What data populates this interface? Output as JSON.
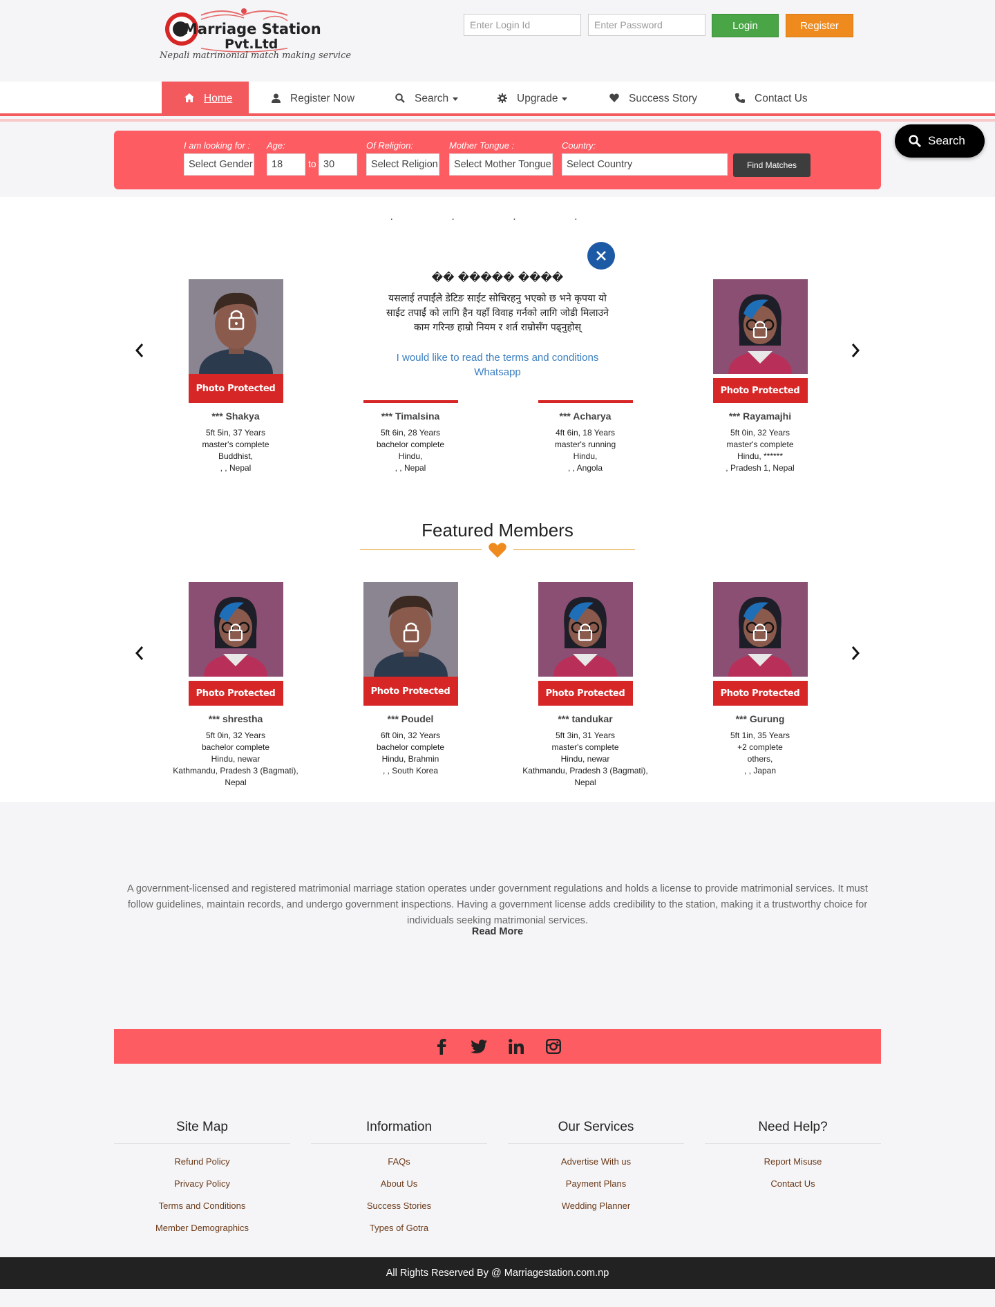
{
  "brand": {
    "name_line1": "Marriage Station",
    "name_line2": "Pvt.Ltd",
    "tagline": "Nepali matrimonial match making service"
  },
  "login": {
    "id_placeholder": "Enter Login Id",
    "password_placeholder": "Enter Password",
    "login_label": "Login",
    "register_label": "Register"
  },
  "nav": {
    "home": "Home",
    "register_now": "Register Now",
    "search": "Search",
    "upgrade": "Upgrade",
    "success_story": "Success Story",
    "contact_us": "Contact Us"
  },
  "search_bar": {
    "looking_for_label": "I am looking for :",
    "gender_value": "Select Gender",
    "age_label": "Age:",
    "age_from": "18",
    "to_label": "to",
    "age_to": "30",
    "religion_label": "Of Religion:",
    "religion_value": "Select Religion",
    "tongue_label": "Mother Tongue :",
    "tongue_value": "Select Mother Tongue",
    "country_label": "Country:",
    "country_value": "Select Country",
    "find_label": "Find Matches"
  },
  "floating_search": {
    "label": "Search"
  },
  "carousel_dots": ". . . .",
  "modal": {
    "title": "�� ����� ����",
    "body": "यसलाई तपाईंले डेटिङ साईट सोचिरहनु भएको छ भने कृपया यो साईट तपाईं को लागि हैन यहाँ विवाह गर्नको लागि जोडी मिलाउने काम गरिन्छ हाम्रो नियम र शर्त राम्रोसँग पढ्नुहोस्",
    "link_terms": "I would like to read the terms and conditions",
    "link_whatsapp": "Whatsapp"
  },
  "photo_protected_label": "Photo Protected",
  "top_members": [
    {
      "name": "*** Shakya",
      "height_age": "5ft 5in, 37 Years",
      "education": "master's complete",
      "religion": "Buddhist,",
      "location": ", , Nepal"
    },
    {
      "name": "*** Timalsina",
      "height_age": "5ft 6in, 28 Years",
      "education": "bachelor complete",
      "religion": "Hindu,",
      "location": ", , Nepal"
    },
    {
      "name": "*** Acharya",
      "height_age": "4ft 6in, 18 Years",
      "education": "master's running",
      "religion": "Hindu,",
      "location": ", , Angola"
    },
    {
      "name": "*** Rayamajhi",
      "height_age": "5ft 0in, 32 Years",
      "education": "master's complete",
      "religion": "Hindu, ******",
      "location": ", Pradesh 1, Nepal"
    }
  ],
  "featured": {
    "title": "Featured Members",
    "members": [
      {
        "name": "*** shrestha",
        "height_age": "5ft 0in, 32 Years",
        "education": "bachelor complete",
        "religion": "Hindu, newar",
        "location": "Kathmandu, Pradesh 3 (Bagmati),",
        "location2": "Nepal"
      },
      {
        "name": "*** Poudel",
        "height_age": "6ft 0in, 32 Years",
        "education": "bachelor complete",
        "religion": "Hindu, Brahmin",
        "location": ", , South Korea",
        "location2": ""
      },
      {
        "name": "*** tandukar",
        "height_age": "5ft 3in, 31 Years",
        "education": "master's complete",
        "religion": "Hindu, newar",
        "location": "Kathmandu, Pradesh 3 (Bagmati),",
        "location2": "Nepal"
      },
      {
        "name": "*** Gurung",
        "height_age": "5ft 1in, 35 Years",
        "education": "+2 complete",
        "religion": "others,",
        "location": ", , Japan",
        "location2": ""
      }
    ]
  },
  "about": {
    "text": "A government-licensed and registered matrimonial marriage station operates under government regulations and holds a license to provide matrimonial services. It must follow guidelines, maintain records, and undergo government inspections. Having a government license adds credibility to the station, making it a trustworthy choice for individuals seeking matrimonial services.",
    "read_more": "Read More"
  },
  "social": [
    "facebook-icon",
    "twitter-icon",
    "linkedin-icon",
    "instagram-icon"
  ],
  "footer": {
    "site_map": {
      "title": "Site Map",
      "links": [
        "Refund Policy",
        "Privacy Policy",
        "Terms and Conditions",
        "Member Demographics"
      ]
    },
    "information": {
      "title": "Information",
      "links": [
        "FAQs",
        "About Us",
        "Success Stories",
        "Types of Gotra"
      ]
    },
    "services": {
      "title": "Our Services",
      "links": [
        "Advertise With us",
        "Payment Plans",
        "Wedding Planner"
      ]
    },
    "help": {
      "title": "Need Help?",
      "links": [
        "Report Misuse",
        "Contact Us"
      ]
    }
  },
  "copyright": "All Rights Reserved By @ Marriagestation.com.np",
  "colors": {
    "accent": "#fd5c63",
    "nav_active": "#f25a5e",
    "login": "#49a545",
    "register": "#ef8b1e",
    "protected": "#d72626",
    "heart": "#ef8b1e"
  }
}
